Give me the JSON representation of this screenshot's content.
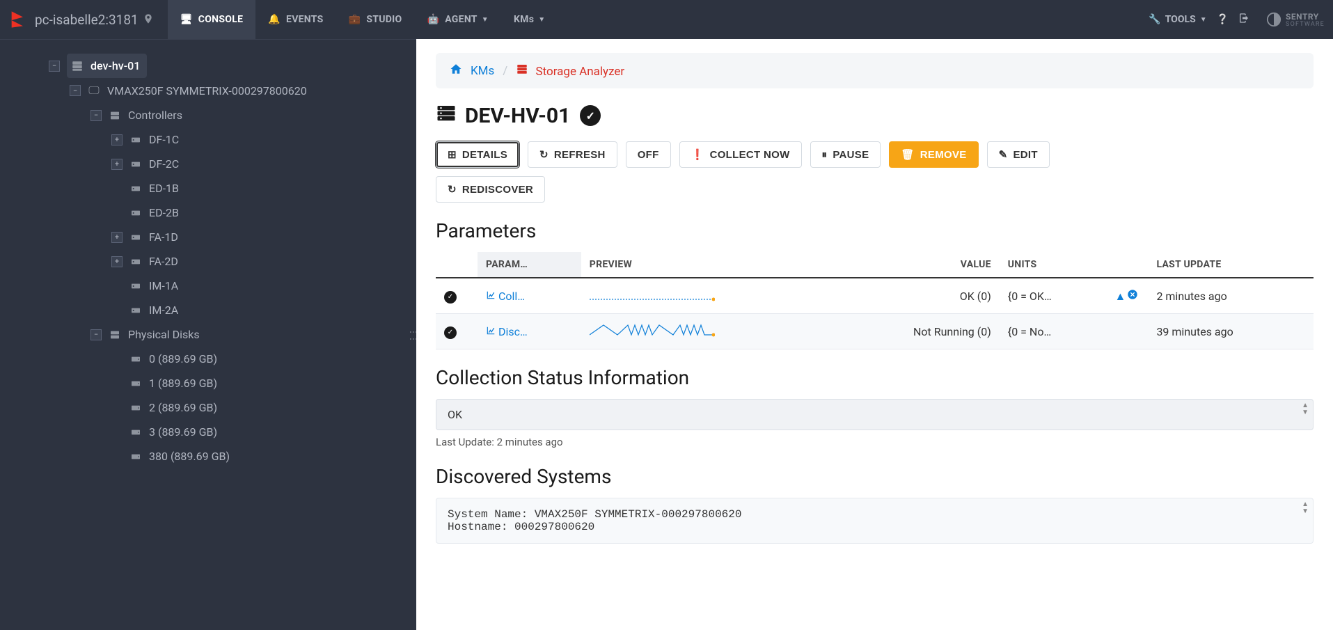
{
  "host": "pc-isabelle2:3181",
  "nav": {
    "tabs": [
      {
        "label": "CONSOLE",
        "icon": "🖥"
      },
      {
        "label": "EVENTS",
        "icon": "🔔"
      },
      {
        "label": "STUDIO",
        "icon": "💼"
      },
      {
        "label": "AGENT",
        "icon": "🤖",
        "caret": true
      },
      {
        "label": "KMs",
        "icon": "",
        "caret": true
      }
    ],
    "right": {
      "tools": "TOOLS"
    }
  },
  "tree": {
    "root": {
      "label": "dev-hv-01"
    },
    "vmax": {
      "label": "VMAX250F SYMMETRIX-000297800620"
    },
    "controllers_label": "Controllers",
    "controllers": [
      {
        "label": "DF-1C",
        "expandable": true
      },
      {
        "label": "DF-2C",
        "expandable": true
      },
      {
        "label": "ED-1B",
        "expandable": false
      },
      {
        "label": "ED-2B",
        "expandable": false
      },
      {
        "label": "FA-1D",
        "expandable": true
      },
      {
        "label": "FA-2D",
        "expandable": true
      },
      {
        "label": "IM-1A",
        "expandable": false
      },
      {
        "label": "IM-2A",
        "expandable": false
      }
    ],
    "physical_disks_label": "Physical Disks",
    "disks": [
      {
        "label": "0 (889.69 GB)"
      },
      {
        "label": "1 (889.69 GB)"
      },
      {
        "label": "2 (889.69 GB)"
      },
      {
        "label": "3 (889.69 GB)"
      },
      {
        "label": "380 (889.69 GB)"
      }
    ]
  },
  "breadcrumb": {
    "kms": "KMs",
    "analyzer": "Storage Analyzer"
  },
  "page": {
    "title": "DEV-HV-01"
  },
  "actions": {
    "details": "DETAILS",
    "refresh": "REFRESH",
    "off": "OFF",
    "collect": "COLLECT NOW",
    "pause": "PAUSE",
    "remove": "REMOVE",
    "edit": "EDIT",
    "rediscover": "REDISCOVER"
  },
  "params": {
    "heading": "Parameters",
    "headers": {
      "param": "PARAM…",
      "preview": "PREVIEW",
      "value": "VALUE",
      "units": "UNITS",
      "lastupdate": "LAST UPDATE"
    },
    "rows": [
      {
        "name": "Coll…",
        "value": "OK (0)",
        "units": "{0 = OK…",
        "lastupdate": "2 minutes ago",
        "indicators": true
      },
      {
        "name": "Disc…",
        "value": "Not Running (0)",
        "units": "{0 = No…",
        "lastupdate": "39 minutes ago",
        "indicators": false
      }
    ]
  },
  "collection_status": {
    "heading": "Collection Status Information",
    "value": "OK",
    "last_update": "Last Update: 2 minutes ago"
  },
  "discovered": {
    "heading": "Discovered Systems",
    "text": "System Name: VMAX250F SYMMETRIX-000297800620\nHostname: 000297800620"
  }
}
